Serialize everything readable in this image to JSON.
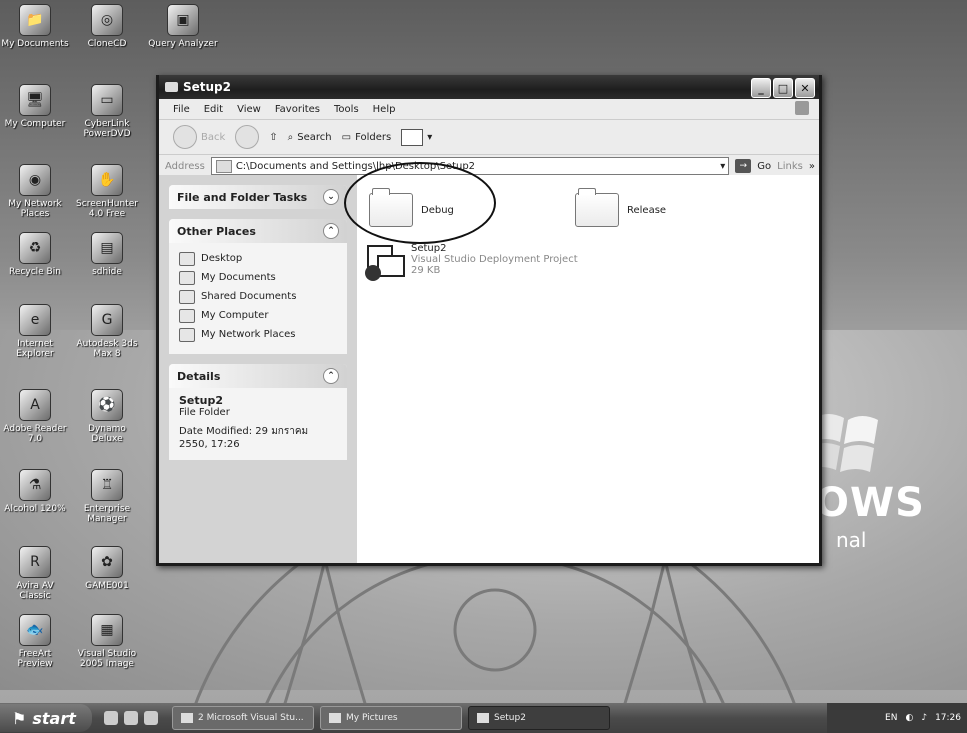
{
  "desktop": {
    "icons": [
      {
        "label": "My Documents",
        "glyph": "📁"
      },
      {
        "label": "CloneCD",
        "glyph": "◎"
      },
      {
        "label": "Query Analyzer",
        "glyph": "▣"
      },
      {
        "label": "My Computer",
        "glyph": "🖥"
      },
      {
        "label": "CyberLink PowerDVD",
        "glyph": "▭"
      },
      {
        "label": "My Network Places",
        "glyph": "◉"
      },
      {
        "label": "ScreenHunter 4.0 Free",
        "glyph": "✋"
      },
      {
        "label": "Recycle Bin",
        "glyph": "♻"
      },
      {
        "label": "sdhide",
        "glyph": "▤"
      },
      {
        "label": "Internet Explorer",
        "glyph": "e"
      },
      {
        "label": "Autodesk 3ds Max 8",
        "glyph": "G"
      },
      {
        "label": "Adobe Reader 7.0",
        "glyph": "A"
      },
      {
        "label": "Dynamo Deluxe",
        "glyph": "⚽"
      },
      {
        "label": "Alcohol 120%",
        "glyph": "⚗"
      },
      {
        "label": "Enterprise Manager",
        "glyph": "♖"
      },
      {
        "label": "Avira AV Classic",
        "glyph": "R"
      },
      {
        "label": "GAME001",
        "glyph": "✿"
      },
      {
        "label": "FreeArt Preview",
        "glyph": "🐟"
      },
      {
        "label": "Visual Studio 2005 Image",
        "glyph": "▦"
      }
    ],
    "brand": "OWS",
    "brand_sub": "nal"
  },
  "window": {
    "title": "Setup2",
    "menu": [
      "File",
      "Edit",
      "View",
      "Favorites",
      "Tools",
      "Help"
    ],
    "toolbar": {
      "back": "Back",
      "search": "Search",
      "folders": "Folders"
    },
    "address": {
      "label": "Address",
      "path": "C:\\Documents and Settings\\lhp\\Desktop\\Setup2",
      "go": "Go",
      "links": "Links"
    },
    "left_pane": {
      "tasks_title": "File and Folder Tasks",
      "other_places_title": "Other Places",
      "other_places": [
        "Desktop",
        "My Documents",
        "Shared Documents",
        "My Computer",
        "My Network Places"
      ],
      "details_title": "Details",
      "details_name": "Setup2",
      "details_type": "File Folder",
      "details_modified": "Date Modified: 29 มกราคม 2550, 17:26"
    },
    "files": [
      {
        "name": "Debug",
        "kind": "folder"
      },
      {
        "name": "Release",
        "kind": "folder"
      },
      {
        "name": "Setup2",
        "line2": "Visual Studio Deployment Project",
        "line3": "29 KB",
        "kind": "project"
      }
    ]
  },
  "taskbar": {
    "start": "start",
    "tasks": [
      {
        "label": "2 Microsoft Visual Stu...",
        "active": false
      },
      {
        "label": "My Pictures",
        "active": false
      },
      {
        "label": "Setup2",
        "active": true
      }
    ],
    "language": "EN",
    "clock": "17:26"
  }
}
